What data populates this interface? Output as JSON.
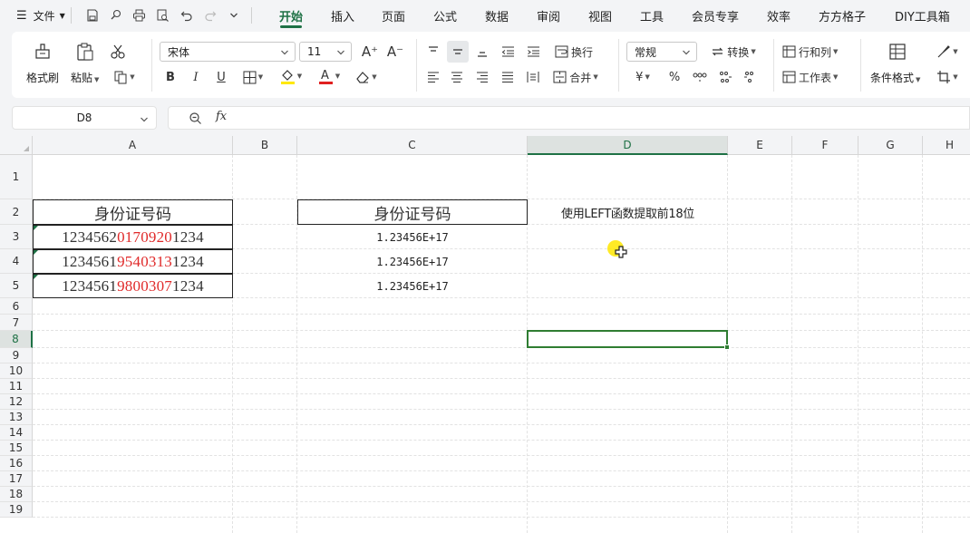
{
  "menu": {
    "file_label": "文件",
    "tabs": [
      "开始",
      "插入",
      "页面",
      "公式",
      "数据",
      "审阅",
      "视图",
      "工具",
      "会员专享",
      "效率",
      "方方格子",
      "DIY工具箱"
    ],
    "active_tab": "开始"
  },
  "ribbon": {
    "format_painter": "格式刷",
    "paste": "粘贴",
    "font_name": "宋体",
    "font_size": "11",
    "wrap_text": "换行",
    "merge": "合并",
    "number_format": "常规",
    "convert": "转换",
    "rows_cols": "行和列",
    "worksheet": "工作表",
    "conditional_format": "条件格式",
    "bold": "B",
    "italic": "I",
    "underline": "U",
    "font_color_letter": "A",
    "currency_symbol": "¥",
    "percent_symbol": "%",
    "grow_font": "A⁺",
    "shrink_font": "A⁻",
    "fill_color": "#ffe800",
    "font_color": "#e02020"
  },
  "formula_bar": {
    "name_box": "D8",
    "fx": "fx",
    "formula": ""
  },
  "sheet": {
    "columns": [
      "A",
      "B",
      "C",
      "D",
      "E",
      "F",
      "G",
      "H"
    ],
    "selected_column": "D",
    "rows": [
      "1",
      "2",
      "3",
      "4",
      "5",
      "6",
      "7",
      "8",
      "9",
      "10",
      "11",
      "12",
      "13",
      "14",
      "15",
      "16",
      "17",
      "18",
      "19"
    ],
    "selected_row": "8",
    "a2_header": "身份证号码",
    "c2_header": "身份证号码",
    "d2_note": "使用LEFT函数提取前18位",
    "ids": [
      {
        "prefix": "1234562",
        "mid": "0170920",
        "suffix": "1234"
      },
      {
        "prefix": "1234561",
        "mid": "9540313",
        "suffix": "1234"
      },
      {
        "prefix": "1234561",
        "mid": "9800307",
        "suffix": "1234"
      }
    ],
    "sci_values": [
      "1.23456E+17",
      "1.23456E+17",
      "1.23456E+17"
    ],
    "selected_cell": "D8",
    "accent": "#1e7145",
    "red_digits": "#e02a2a"
  }
}
